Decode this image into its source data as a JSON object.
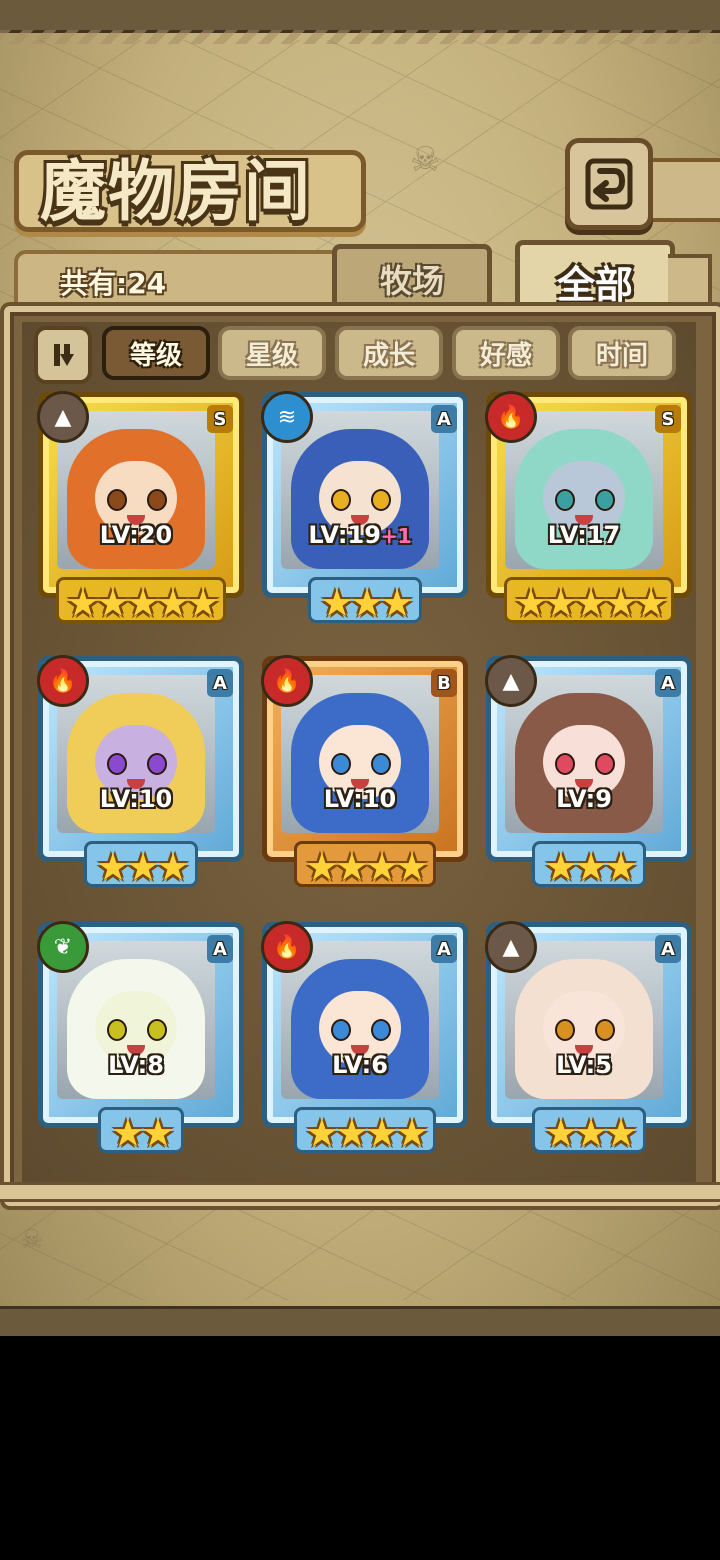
{
  "screen": {
    "title": "魔物房间",
    "count_label": "共有:24"
  },
  "tabs": [
    {
      "label": "牧场",
      "active": false
    },
    {
      "label": "全部",
      "active": true
    }
  ],
  "sort": {
    "buttons": [
      {
        "label": "等级",
        "active": true
      },
      {
        "label": "星级",
        "active": false
      },
      {
        "label": "成长",
        "active": false
      },
      {
        "label": "好感",
        "active": false
      },
      {
        "label": "时间",
        "active": false
      }
    ]
  },
  "cards": [
    {
      "level": "LV:20",
      "plus": "",
      "rank": "S",
      "stars": 5,
      "element": "earth-icon",
      "element_color": "#6b5848",
      "frame": "gold",
      "hair": "#e0702a",
      "skin": "#f8dcc2",
      "eye": "#8a4a1c"
    },
    {
      "level": "LV:19",
      "plus": "+1",
      "rank": "A",
      "stars": 3,
      "element": "water-icon",
      "element_color": "#2e8fd0",
      "frame": "blue",
      "hair": "#3a5fb8",
      "skin": "#f6e2d0",
      "eye": "#e8b020"
    },
    {
      "level": "LV:17",
      "plus": "",
      "rank": "S",
      "stars": 5,
      "element": "fire-icon",
      "element_color": "#c82a2a",
      "frame": "gold",
      "hair": "#8fd8c8",
      "skin": "#b8c8d8",
      "eye": "#3aa0a0"
    },
    {
      "level": "LV:10",
      "plus": "",
      "rank": "A",
      "stars": 3,
      "element": "fire-icon",
      "element_color": "#c82a2a",
      "frame": "blue",
      "hair": "#f0cc58",
      "skin": "#c8b0e0",
      "eye": "#8a4ad0"
    },
    {
      "level": "LV:10",
      "plus": "",
      "rank": "B",
      "stars": 4,
      "element": "fire-icon",
      "element_color": "#c82a2a",
      "frame": "bronze",
      "hair": "#3c6cc8",
      "skin": "#fbe6d6",
      "eye": "#3a8ad8"
    },
    {
      "level": "LV:9",
      "plus": "",
      "rank": "A",
      "stars": 3,
      "element": "earth-icon",
      "element_color": "#6b5848",
      "frame": "blue",
      "hair": "#8a5a48",
      "skin": "#f8e0d8",
      "eye": "#e04a60"
    },
    {
      "level": "LV:8",
      "plus": "",
      "rank": "A",
      "stars": 2,
      "element": "leaf-icon",
      "element_color": "#3a9a3a",
      "frame": "blue",
      "hair": "#f4f8ec",
      "skin": "#f0f4d8",
      "eye": "#c8c020"
    },
    {
      "level": "LV:6",
      "plus": "",
      "rank": "A",
      "stars": 4,
      "element": "fire-icon",
      "element_color": "#c82a2a",
      "frame": "blue",
      "hair": "#3c6cc8",
      "skin": "#fbe6d6",
      "eye": "#3a8ad8"
    },
    {
      "level": "LV:5",
      "plus": "",
      "rank": "A",
      "stars": 3,
      "element": "earth-icon",
      "element_color": "#6b5848",
      "frame": "blue",
      "hair": "#f4e0d0",
      "skin": "#f8e4d8",
      "eye": "#d89020"
    }
  ]
}
